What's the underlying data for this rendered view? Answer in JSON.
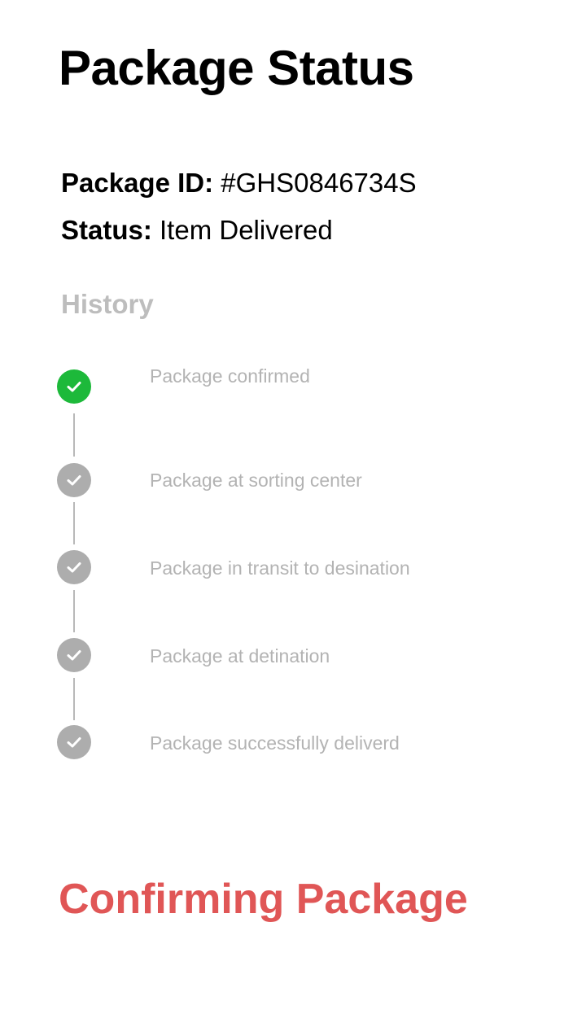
{
  "title": "Package Status",
  "info": {
    "id_label": "Package ID:",
    "id_value": "#GHS0846734S",
    "status_label": "Status:",
    "status_value": "Item Delivered"
  },
  "history": {
    "heading": "History",
    "steps": [
      {
        "label": "Package confirmed",
        "state": "complete"
      },
      {
        "label": "Package at sorting center",
        "state": "pending"
      },
      {
        "label": "Package in transit to desination",
        "state": "pending"
      },
      {
        "label": "Package at detination",
        "state": "pending"
      },
      {
        "label": "Package successfully deliverd",
        "state": "pending"
      }
    ]
  },
  "footer": {
    "status_text": "Confirming Package"
  },
  "colors": {
    "complete": "#1db93a",
    "pending": "#adadad",
    "muted_text": "#b3b3b3",
    "heading_muted": "#bdbdbd",
    "accent_red": "#e05656"
  },
  "icons": {
    "step": "check-circle-icon"
  }
}
